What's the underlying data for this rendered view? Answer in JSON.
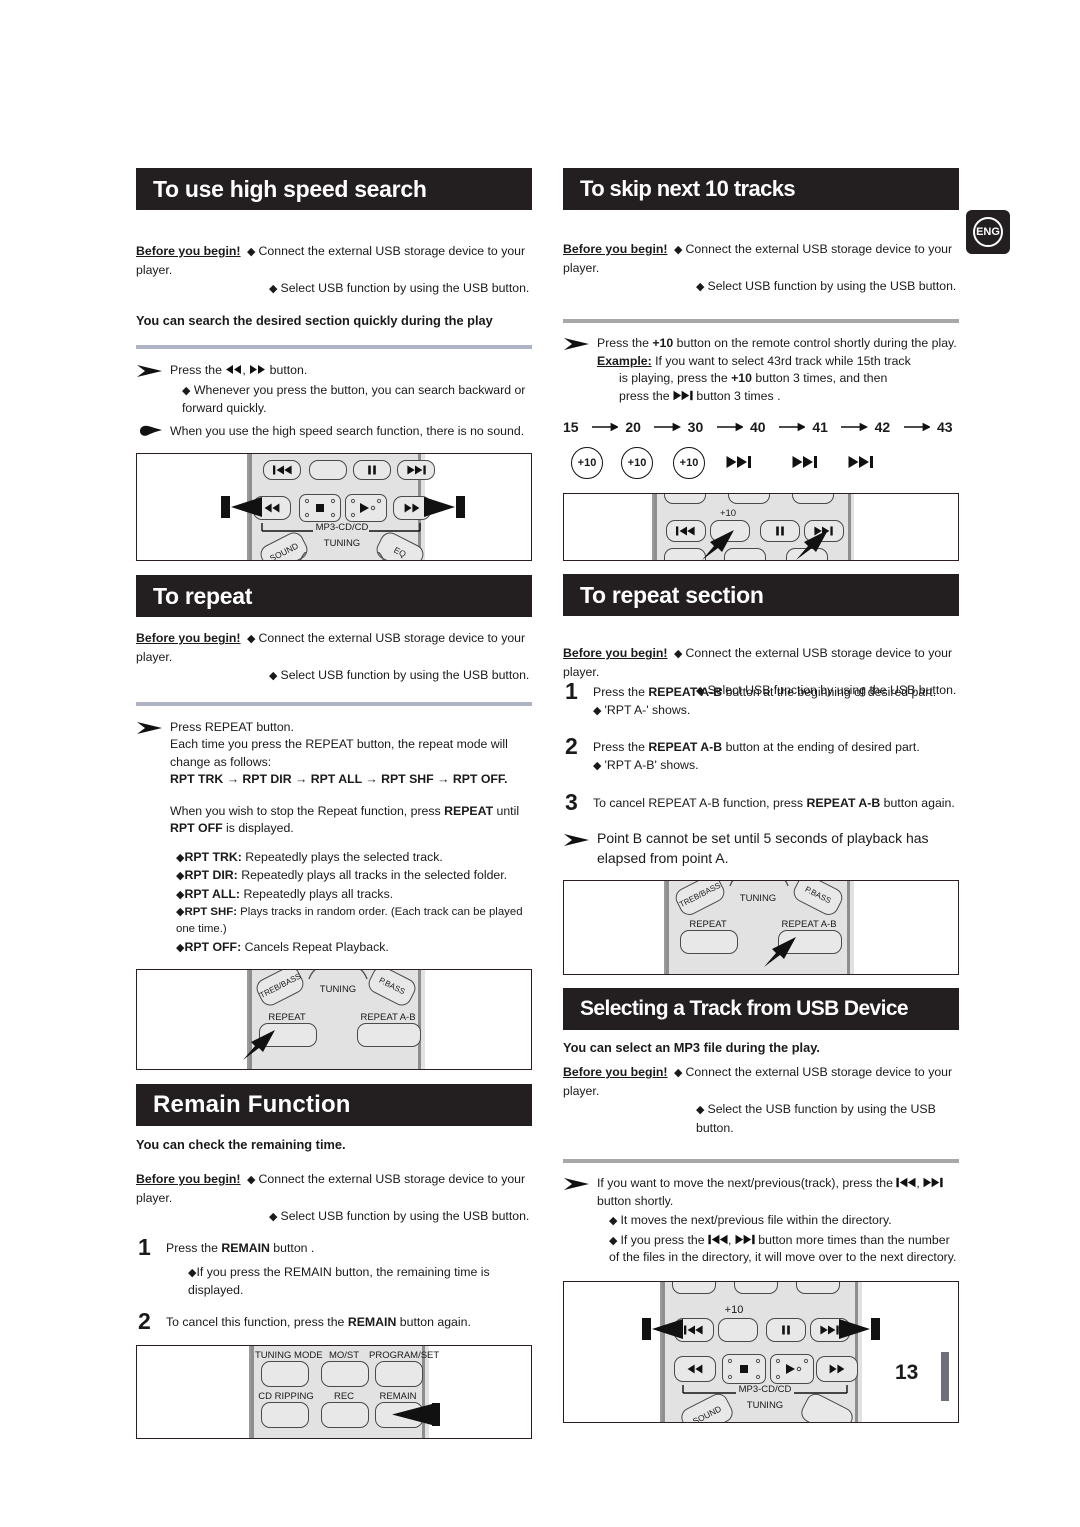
{
  "page": {
    "number": "13",
    "language_badge": "ENG"
  },
  "colors": {
    "banner_bg": "#231f20",
    "banner_text": "#ffffff",
    "rule": "#aeb4c4",
    "rule_alt": "#a8a8a8",
    "page_bar": "#6f6f78",
    "remote_body": "#e2e2e2"
  },
  "common": {
    "before_label": "Before you begin!",
    "before_line1": "Connect the external USB storage device to your player.",
    "before_line2": "Select USB function by using the USB button.",
    "before_line2_alt": "Select the USB function by using the USB button."
  },
  "sections": {
    "high_speed_search": {
      "title": "To use high speed search",
      "lead": "You can search the desired section quickly during the play",
      "step_text_a": "Press the",
      "step_text_b": ",",
      "step_text_c": "button.",
      "bullet1": "Whenever you press the button, you can search backward or forward quickly.",
      "hand_note": "When you use the high speed search function, there is no sound.",
      "remote": {
        "caption_mp3": "MP3-CD/CD",
        "caption_tuning": "TUNING",
        "caption_sound": "SOUND",
        "caption_eq": "EQ"
      }
    },
    "to_repeat": {
      "title": "To repeat",
      "line1": "Press REPEAT button.",
      "line2": "Each time you press the REPEAT button, the repeat mode will change as follows:",
      "sequence": "RPT TRK → RPT DIR → RPT ALL → RPT SHF → RPT OFF.",
      "stop_a": "When you wish to stop the Repeat function, press ",
      "stop_b": "REPEAT",
      "stop_c": " until ",
      "stop_d": "RPT OFF",
      "stop_e": " is displayed.",
      "modes": [
        {
          "name": "RPT TRK:",
          "desc": "Repeatedly plays the selected track."
        },
        {
          "name": "RPT DIR:",
          "desc": "Repeatedly plays all tracks in the selected folder."
        },
        {
          "name": "RPT ALL:",
          "desc": "Repeatedly plays all tracks."
        },
        {
          "name": "RPT SHF:",
          "desc": "Plays tracks in random order. (Each track can be played one time.)"
        },
        {
          "name": "RPT OFF:",
          "desc": "Cancels Repeat Playback."
        }
      ],
      "remote": {
        "treb_bass": "TREB/BASS",
        "tuning": "TUNING",
        "pbass": "P.BASS",
        "repeat": "REPEAT",
        "repeat_ab": "REPEAT A-B"
      }
    },
    "remain_function": {
      "title": "Remain Function",
      "lead": "You can check the remaining time.",
      "step1_a": "Press the ",
      "step1_b": "REMAIN",
      "step1_c": " button .",
      "step1_bullet": "If you press the REMAIN button, the remaining time is displayed.",
      "step2_a": "To cancel this function, press the ",
      "step2_b": "REMAIN",
      "step2_c": " button again.",
      "remote": {
        "tuning_mode": "TUNING MODE",
        "mo_st": "MO/ST",
        "program_set": "PROGRAM/SET",
        "cd_ripping": "CD RIPPING",
        "rec": "REC",
        "remain": "REMAIN"
      }
    },
    "skip_10_tracks": {
      "title": "To skip next 10 tracks",
      "line_a": "Press the ",
      "line_b": "+10",
      "line_c": " button on the remote control shortly during the play.",
      "example_label": "Example:",
      "example_a": " If you want to select 43rd track while 15th track",
      "example_b": "is playing, press the ",
      "example_c": "+10",
      "example_d": " button 3 times, and then",
      "example_e": "press the ",
      "example_f": " button 3 times .",
      "chain": [
        "15",
        "20",
        "30",
        "40",
        "41",
        "42",
        "43"
      ],
      "button_sequence": [
        "+10",
        "+10",
        "+10",
        "skip-fwd",
        "skip-fwd",
        "skip-fwd"
      ],
      "remote": {
        "plus10": "+10"
      }
    },
    "repeat_section": {
      "title": "To repeat section",
      "steps": [
        {
          "num": "1",
          "a": "Press the ",
          "b": "REPEAT A-B",
          "c": " button at the beginning of desired part.",
          "bullet": "'RPT A-' shows."
        },
        {
          "num": "2",
          "a": "Press the ",
          "b": "REPEAT A-B",
          "c": " button at the ending of desired part.",
          "bullet": "'RPT A-B' shows."
        },
        {
          "num": "3",
          "a": "To cancel REPEAT A-B function, press ",
          "b": "REPEAT A-B",
          "c": " button again.",
          "bullet": ""
        }
      ],
      "note": "Point B cannot be set until 5 seconds of playback has elapsed from point A.",
      "remote": {
        "treb_bass": "TREB/BASS",
        "tuning": "TUNING",
        "pbass": "P.BASS",
        "repeat": "REPEAT",
        "repeat_ab": "REPEAT A-B"
      }
    },
    "select_track_usb": {
      "title": "Selecting a Track from USB Device",
      "lead": "You can select an MP3 file during the play.",
      "line_a": "If you want to move the next/previous(track), press the",
      "line_b": "button shortly.",
      "bullet1": "It moves the next/previous file within the directory.",
      "bullet2_a": "If you press the",
      "bullet2_b": "button more times than the number of the files in the directory, it will move over to the next directory.",
      "remote": {
        "plus10": "+10",
        "caption_mp3": "MP3-CD/CD",
        "caption_tuning": "TUNING",
        "caption_sound": "SOUND"
      }
    }
  }
}
